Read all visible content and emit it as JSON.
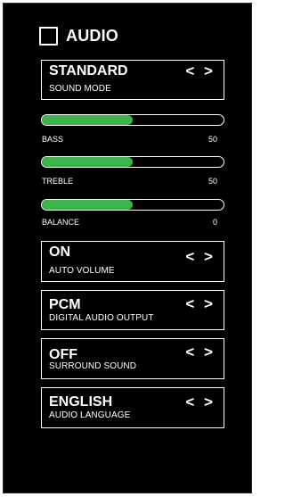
{
  "header": {
    "title": "AUDIO"
  },
  "sound_mode": {
    "value": "STANDARD",
    "label": "SOUND MODE",
    "arrows": "< >"
  },
  "sliders": [
    {
      "label": "BASS",
      "value": "50",
      "level": 0.5
    },
    {
      "label": "TREBLE",
      "value": "50",
      "level": 0.5
    },
    {
      "label": "BALANCE",
      "value": "0",
      "level": 0.5
    }
  ],
  "options": [
    {
      "value": "ON",
      "label": "AUTO VOLUME",
      "arrows": "< >"
    },
    {
      "value": "PCM",
      "label": "DIGITAL AUDIO OUTPUT",
      "arrows": "< >"
    },
    {
      "value": "OFF",
      "label": "SURROUND SOUND",
      "arrows": "< >"
    },
    {
      "value": "ENGLISH",
      "label": "AUDIO LANGUAGE",
      "arrows": "< >"
    }
  ],
  "colors": {
    "background": "#000000",
    "slider_fill": "#3bb54a",
    "text": "#ffffff"
  }
}
